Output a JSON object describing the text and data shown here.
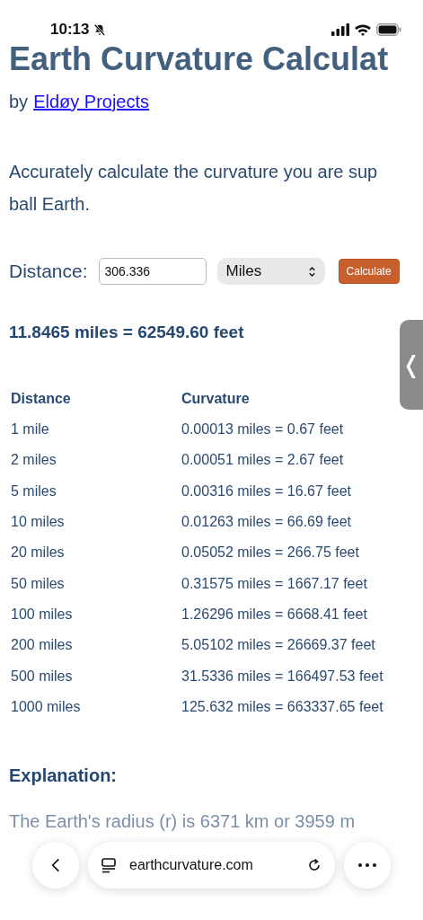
{
  "status_bar": {
    "time": "10:13",
    "silenced": true
  },
  "title": "Earth Curvature Calculat",
  "byline": {
    "prefix": "by",
    "link": "Eldøy Projects"
  },
  "intro_lines": [
    "Accurately calculate the curvature you are sup",
    "ball Earth."
  ],
  "form": {
    "label": "Distance:",
    "value": "306.336",
    "unit": "Miles",
    "button": "Calculate"
  },
  "result": "11.8465 miles = 62549.60 feet",
  "side_tab": {
    "glyph": "❬"
  },
  "table": {
    "columns": [
      "Distance",
      "Curvature"
    ],
    "rows": [
      [
        "1 mile",
        "0.00013 miles = 0.67 feet"
      ],
      [
        "2 miles",
        "0.00051 miles = 2.67 feet"
      ],
      [
        "5 miles",
        "0.00316 miles = 16.67 feet"
      ],
      [
        "10 miles",
        "0.01263 miles = 66.69 feet"
      ],
      [
        "20 miles",
        "0.05052 miles = 266.75 feet"
      ],
      [
        "50 miles",
        "0.31575 miles = 1667.17 feet"
      ],
      [
        "100 miles",
        "1.26296 miles = 6668.41 feet"
      ],
      [
        "200 miles",
        "5.05102 miles = 26669.37 feet"
      ],
      [
        "500 miles",
        "31.5336 miles = 166497.53 feet"
      ],
      [
        "1000 miles",
        "125.632 miles = 663337.65 feet"
      ]
    ]
  },
  "explanation": {
    "heading": "Explanation:",
    "text": "The Earth's radius (r) is 6371 km or 3959 m"
  },
  "browser_bar": {
    "url": "earthcurvature.com"
  }
}
